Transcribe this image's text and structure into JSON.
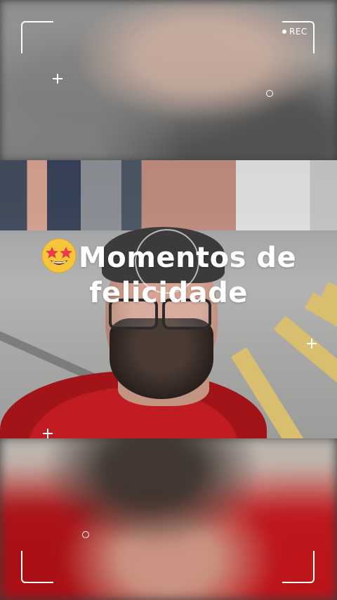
{
  "overlay": {
    "rec_label": "REC",
    "headline_line1": "Momentos de",
    "headline_line2": "felicidade",
    "emoji_icon": "star-struck-emoji"
  },
  "colors": {
    "text": "#ffffff",
    "shirt": "#c01c22",
    "road_stripe": "#d8be6e"
  }
}
